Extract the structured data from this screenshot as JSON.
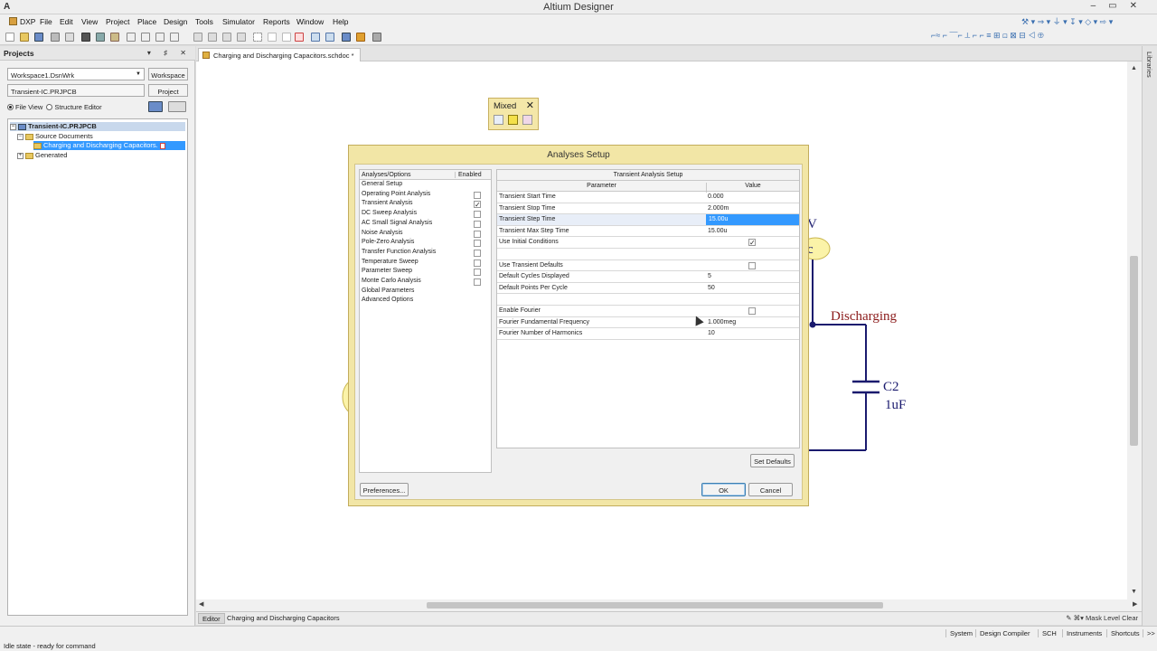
{
  "app": {
    "title": "Altium Designer",
    "icon": "A"
  },
  "menu": {
    "dxp": "DXP",
    "items": [
      "File",
      "Edit",
      "View",
      "Project",
      "Place",
      "Design",
      "Tools",
      "Simulator",
      "Reports",
      "Window",
      "Help"
    ]
  },
  "projects_panel": {
    "title": "Projects",
    "workspace_combo": "Workspace1.DsnWrk",
    "workspace_button": "Workspace",
    "project_field": "Transient-IC.PRJPCB",
    "project_button": "Project",
    "file_view": "File View",
    "structure_editor": "Structure Editor",
    "tree": {
      "project": "Transient-IC.PRJPCB",
      "source_documents": "Source Documents",
      "document": "Charging and Discharging Capacitors.",
      "generated": "Generated"
    }
  },
  "document": {
    "tab": "Charging and Discharging Capacitors.schdoc *",
    "schematic": {
      "label_v": "V",
      "label_c": "c",
      "label_discharging": "Discharging",
      "label_c2": "C2",
      "label_1uf": "1uF"
    }
  },
  "libraries_strip": "Libraries",
  "mixed_toolbar": {
    "title": "Mixed"
  },
  "dialog": {
    "title": "Analyses Setup",
    "analyses_header": "Analyses/Options",
    "enabled_header": "Enabled",
    "analyses": [
      {
        "label": "General Setup",
        "checkbox": false,
        "checked": false
      },
      {
        "label": "Operating Point Analysis",
        "checkbox": true,
        "checked": false
      },
      {
        "label": "Transient Analysis",
        "checkbox": true,
        "checked": true
      },
      {
        "label": "DC Sweep Analysis",
        "checkbox": true,
        "checked": false
      },
      {
        "label": "AC Small Signal Analysis",
        "checkbox": true,
        "checked": false
      },
      {
        "label": "Noise Analysis",
        "checkbox": true,
        "checked": false
      },
      {
        "label": "Pole-Zero Analysis",
        "checkbox": true,
        "checked": false
      },
      {
        "label": "Transfer Function Analysis",
        "checkbox": true,
        "checked": false
      },
      {
        "label": "Temperature Sweep",
        "checkbox": true,
        "checked": false
      },
      {
        "label": "Parameter Sweep",
        "checkbox": true,
        "checked": false
      },
      {
        "label": "Monte Carlo Analysis",
        "checkbox": true,
        "checked": false
      },
      {
        "label": "Global Parameters",
        "checkbox": false,
        "checked": false
      },
      {
        "label": "Advanced Options",
        "checkbox": false,
        "checked": false
      }
    ],
    "panel_title": "Transient Analysis Setup",
    "param_header": "Parameter",
    "value_header": "Value",
    "params": [
      {
        "name": "Transient Start Time",
        "value": "0.000"
      },
      {
        "name": "Transient Stop Time",
        "value": "2.000m"
      },
      {
        "name": "Transient Step Time",
        "value": "15.00u",
        "selected": true
      },
      {
        "name": "Transient Max Step Time",
        "value": "15.00u"
      },
      {
        "name": "Use Initial Conditions",
        "value": "",
        "check": true
      },
      {
        "name": "",
        "value": ""
      },
      {
        "name": "Use Transient Defaults",
        "value": "",
        "check": false
      },
      {
        "name": "Default Cycles Displayed",
        "value": "5"
      },
      {
        "name": "Default Points Per Cycle",
        "value": "50"
      },
      {
        "name": "",
        "value": ""
      },
      {
        "name": "Enable Fourier",
        "value": "",
        "check": false
      },
      {
        "name": "Fourier Fundamental Frequency",
        "value": "1.000meg"
      },
      {
        "name": "Fourier Number of Harmonics",
        "value": "10"
      }
    ],
    "set_defaults": "Set Defaults",
    "preferences": "Preferences...",
    "ok": "OK",
    "cancel": "Cancel"
  },
  "editor_tabs": {
    "editor": "Editor",
    "doc": "Charging and Discharging Capacitors",
    "mask_level": "Mask Level",
    "clear": "Clear"
  },
  "statusbar": {
    "message": "Idle state - ready for command",
    "buttons": [
      "System",
      "Design Compiler",
      "SCH",
      "Instruments",
      "Shortcuts",
      ">>"
    ]
  },
  "colors": {
    "dialog_frame": "#f2e6a6",
    "selection": "#3399ff",
    "wire": "#1a1a6e",
    "net_label": "#8b1a1a"
  }
}
